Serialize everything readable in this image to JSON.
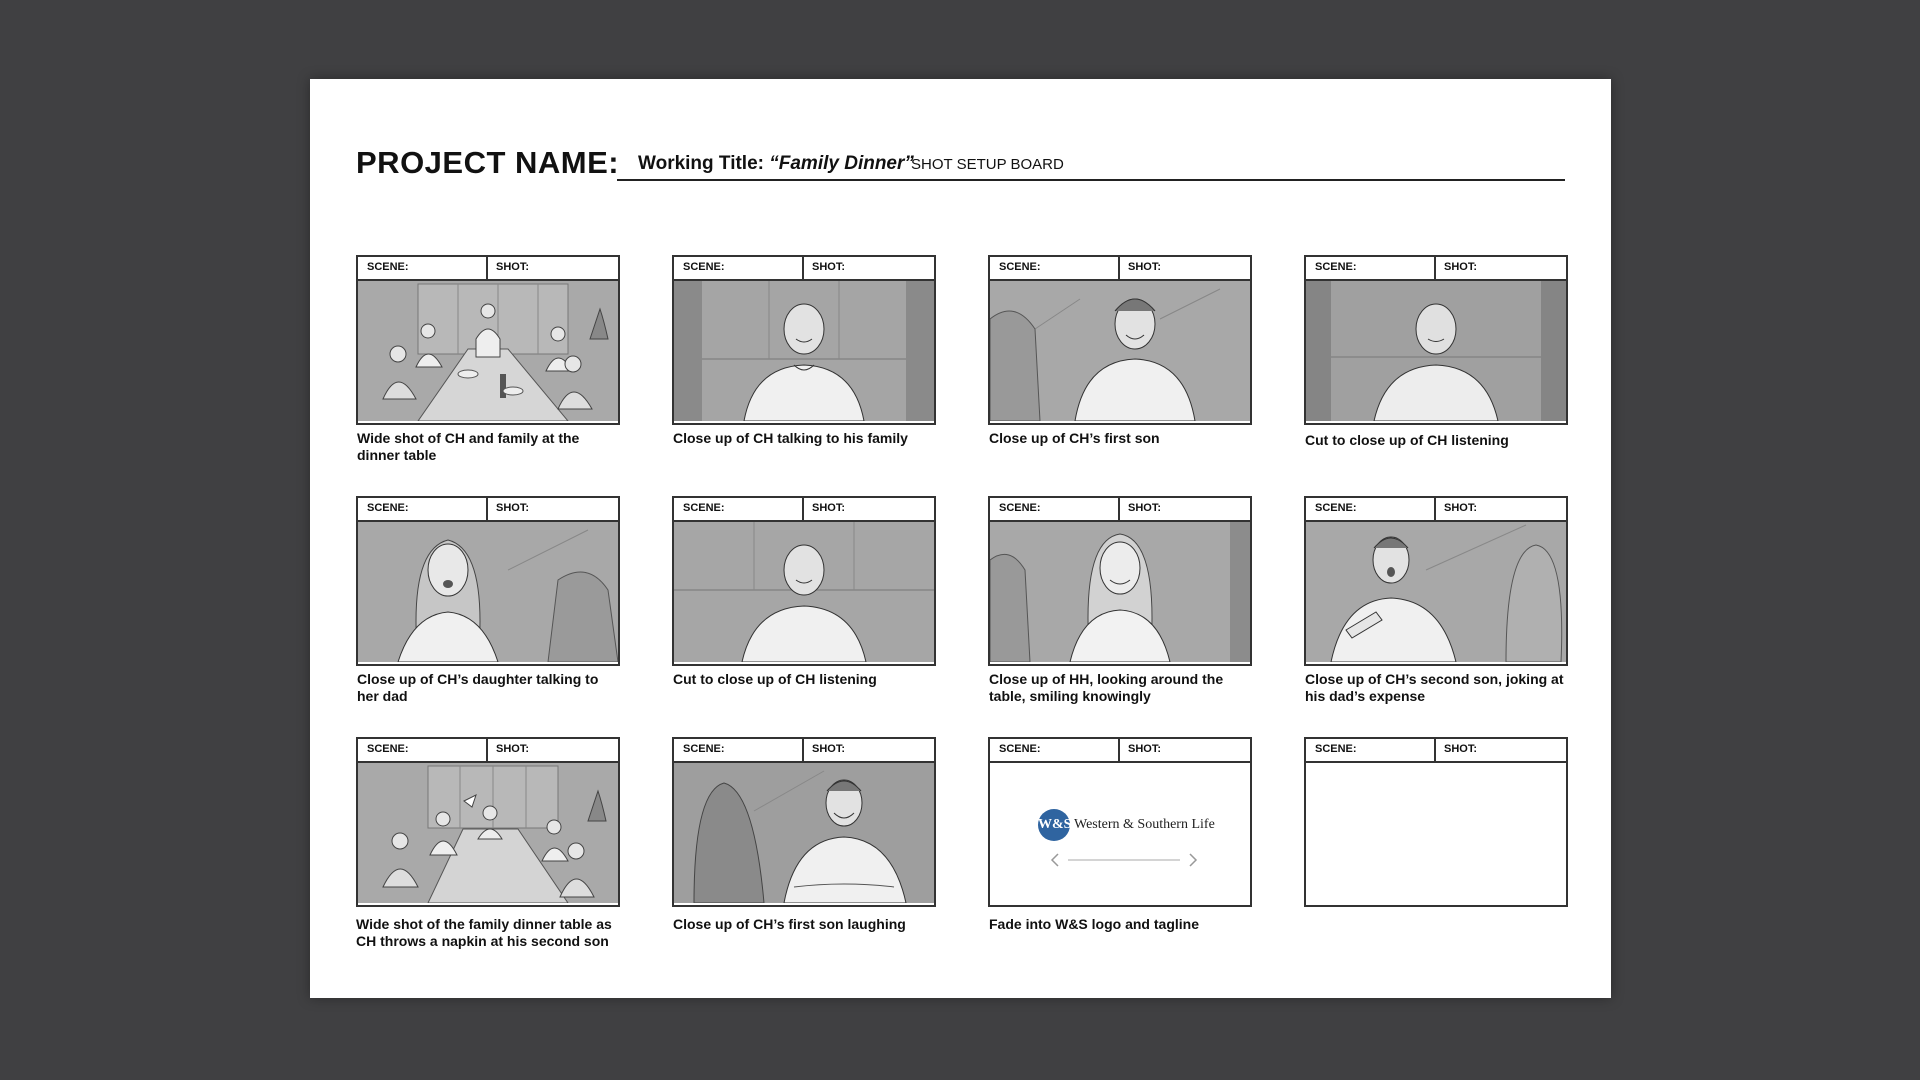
{
  "header": {
    "project_label": "PROJECT NAME:",
    "working_title_prefix": "Working Title:",
    "working_title_name": "“Family Dinner”",
    "board_label": "SHOT SETUP BOARD"
  },
  "frame_labels": {
    "scene": "SCENE:",
    "shot": "SHOT:"
  },
  "panels": [
    {
      "caption": "Wide shot of CH and family at the dinner table"
    },
    {
      "caption": "Close up of CH talking to his family"
    },
    {
      "caption": "Close up of CH’s first son"
    },
    {
      "caption": "Cut to close up of CH listening"
    },
    {
      "caption": "Close up of CH’s daughter talking to her dad"
    },
    {
      "caption": "Cut to close up of CH listening"
    },
    {
      "caption": "Close up of HH, looking around the table, smiling knowingly"
    },
    {
      "caption": "Close up of CH’s second son, joking at his dad’s expense"
    },
    {
      "caption": "Wide shot of the family dinner table as CH throws a napkin at his second son"
    },
    {
      "caption": "Close up of CH’s first son laughing"
    },
    {
      "caption": "Fade into W&S logo and tagline"
    },
    {
      "caption": ""
    }
  ],
  "logo": {
    "badge": "W&S",
    "wordmark": "Western & Southern Life"
  }
}
